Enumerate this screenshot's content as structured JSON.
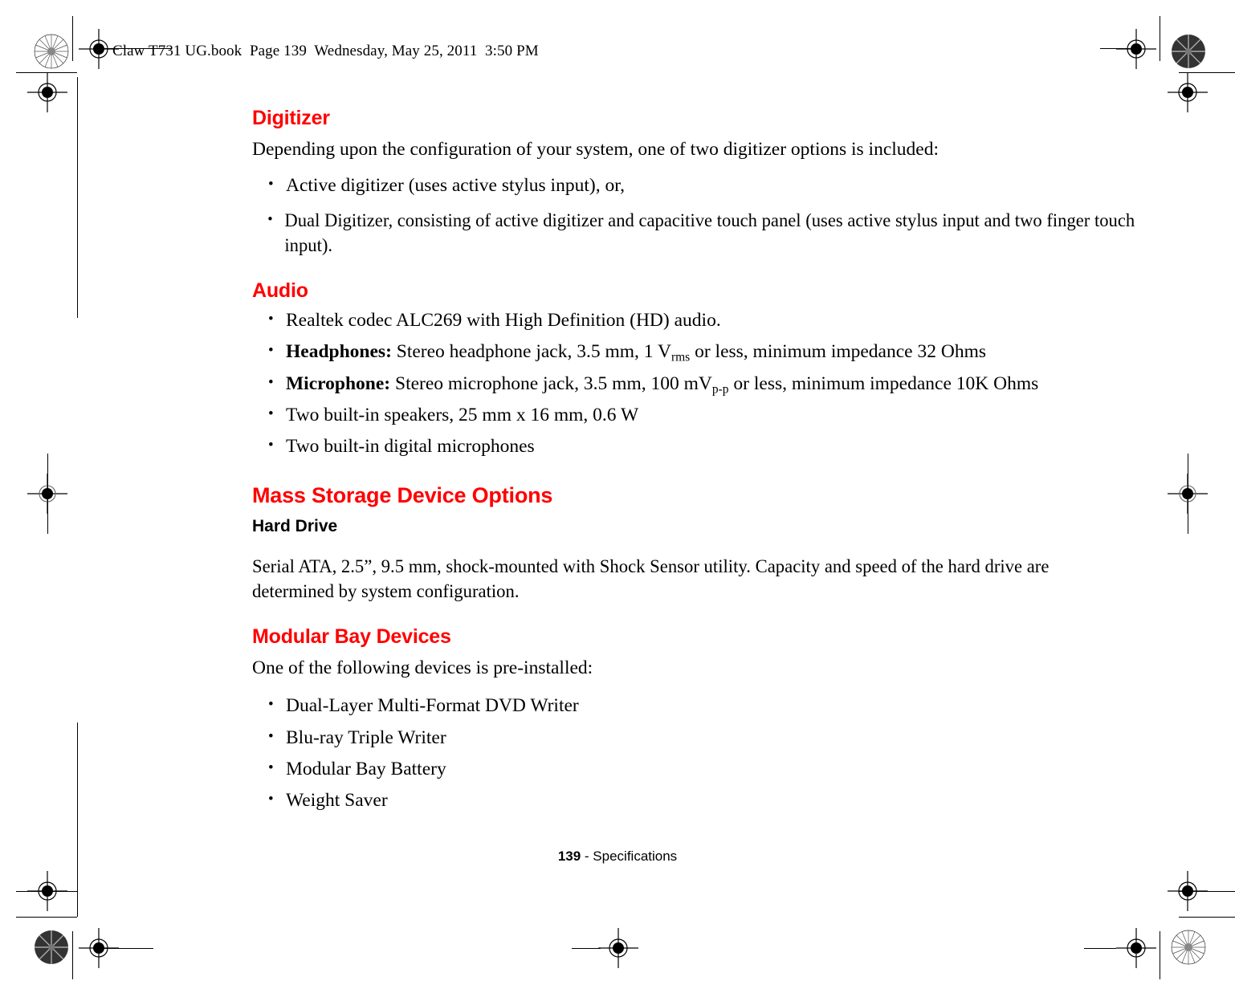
{
  "header": {
    "slug": "Claw T731 UG.book  Page 139  Wednesday, May 25, 2011  3:50 PM"
  },
  "colors": {
    "heading_red": "#FF0000",
    "text_black": "#000000",
    "page_background": "#FFFFFF"
  },
  "sections": {
    "digitizer": {
      "heading": "Digitizer",
      "intro": "Depending upon the configuration of your system, one of two digitizer options is included:",
      "bullets": [
        "Active digitizer (uses active stylus input), or,",
        "Dual Digitizer, consisting of active digitizer and capacitive touch panel (uses active stylus input and two finger touch input)."
      ]
    },
    "audio": {
      "heading": "Audio",
      "bullets": [
        {
          "label": "",
          "text": "Realtek codec ALC269 with High Definition (HD) audio."
        },
        {
          "label": "Headphones:",
          "text_before_sub": " Stereo headphone jack, 3.5 mm, 1 V",
          "sub": "rms",
          "text_after_sub": " or less, minimum impedance 32 Ohms"
        },
        {
          "label": "Microphone:",
          "text_before_sub": " Stereo microphone jack, 3.5 mm, 100 mV",
          "sub": "p-p",
          "text_after_sub": " or less, minimum impedance 10K Ohms"
        },
        {
          "label": "",
          "text": "Two built-in speakers, 25 mm x 16 mm, 0.6 W"
        },
        {
          "label": "",
          "text": "Two built-in digital microphones"
        }
      ]
    },
    "mass_storage": {
      "heading": "Mass Storage Device Options",
      "hard_drive": {
        "subheading": "Hard Drive",
        "text": "Serial ATA, 2.5”, 9.5 mm, shock-mounted with Shock Sensor utility. Capacity and speed of the hard drive are determined by system configuration."
      },
      "modular_bay": {
        "heading": "Modular Bay Devices",
        "intro": "One of the following devices is pre-installed:",
        "bullets": [
          "Dual-Layer Multi-Format DVD Writer",
          "Blu-ray Triple Writer",
          "Modular Bay Battery",
          "Weight Saver"
        ]
      }
    }
  },
  "footer": {
    "page_number": "139",
    "separator_and_title": " - Specifications"
  }
}
